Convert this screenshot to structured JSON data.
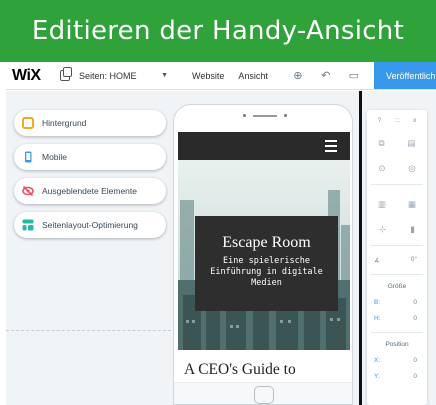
{
  "banner": {
    "title": "Editieren der Handy-Ansicht"
  },
  "topbar": {
    "logo": "WiX",
    "pages_label": "Seiten: HOME",
    "nav": [
      "Website",
      "Ansicht"
    ],
    "publish": "Veröffentlich"
  },
  "sidebar": {
    "items": [
      {
        "label": "Hintergrund",
        "color": "#f5a623"
      },
      {
        "label": "Mobile",
        "color": "#3899ec"
      },
      {
        "label": "Ausgeblendete Elemente",
        "color": "#ee4f6a"
      },
      {
        "label": "Seitenlayout-Optimierung",
        "color": "#26b8a6"
      }
    ]
  },
  "phone": {
    "hero_title": "Escape Room",
    "hero_subtitle": "Eine spielerische Einführung in digitale Medien",
    "blog_title": "A CEO's Guide to"
  },
  "inspector": {
    "help": "?",
    "grip": ":::",
    "close": "x",
    "rotation": "0°",
    "size_label": "Größe",
    "size_b_label": "B:",
    "size_b_value": "0",
    "size_h_label": "H:",
    "size_h_value": "0",
    "position_label": "Position",
    "pos_x_label": "X:",
    "pos_x_value": "0",
    "pos_y_label": "Y:",
    "pos_y_value": "0"
  }
}
